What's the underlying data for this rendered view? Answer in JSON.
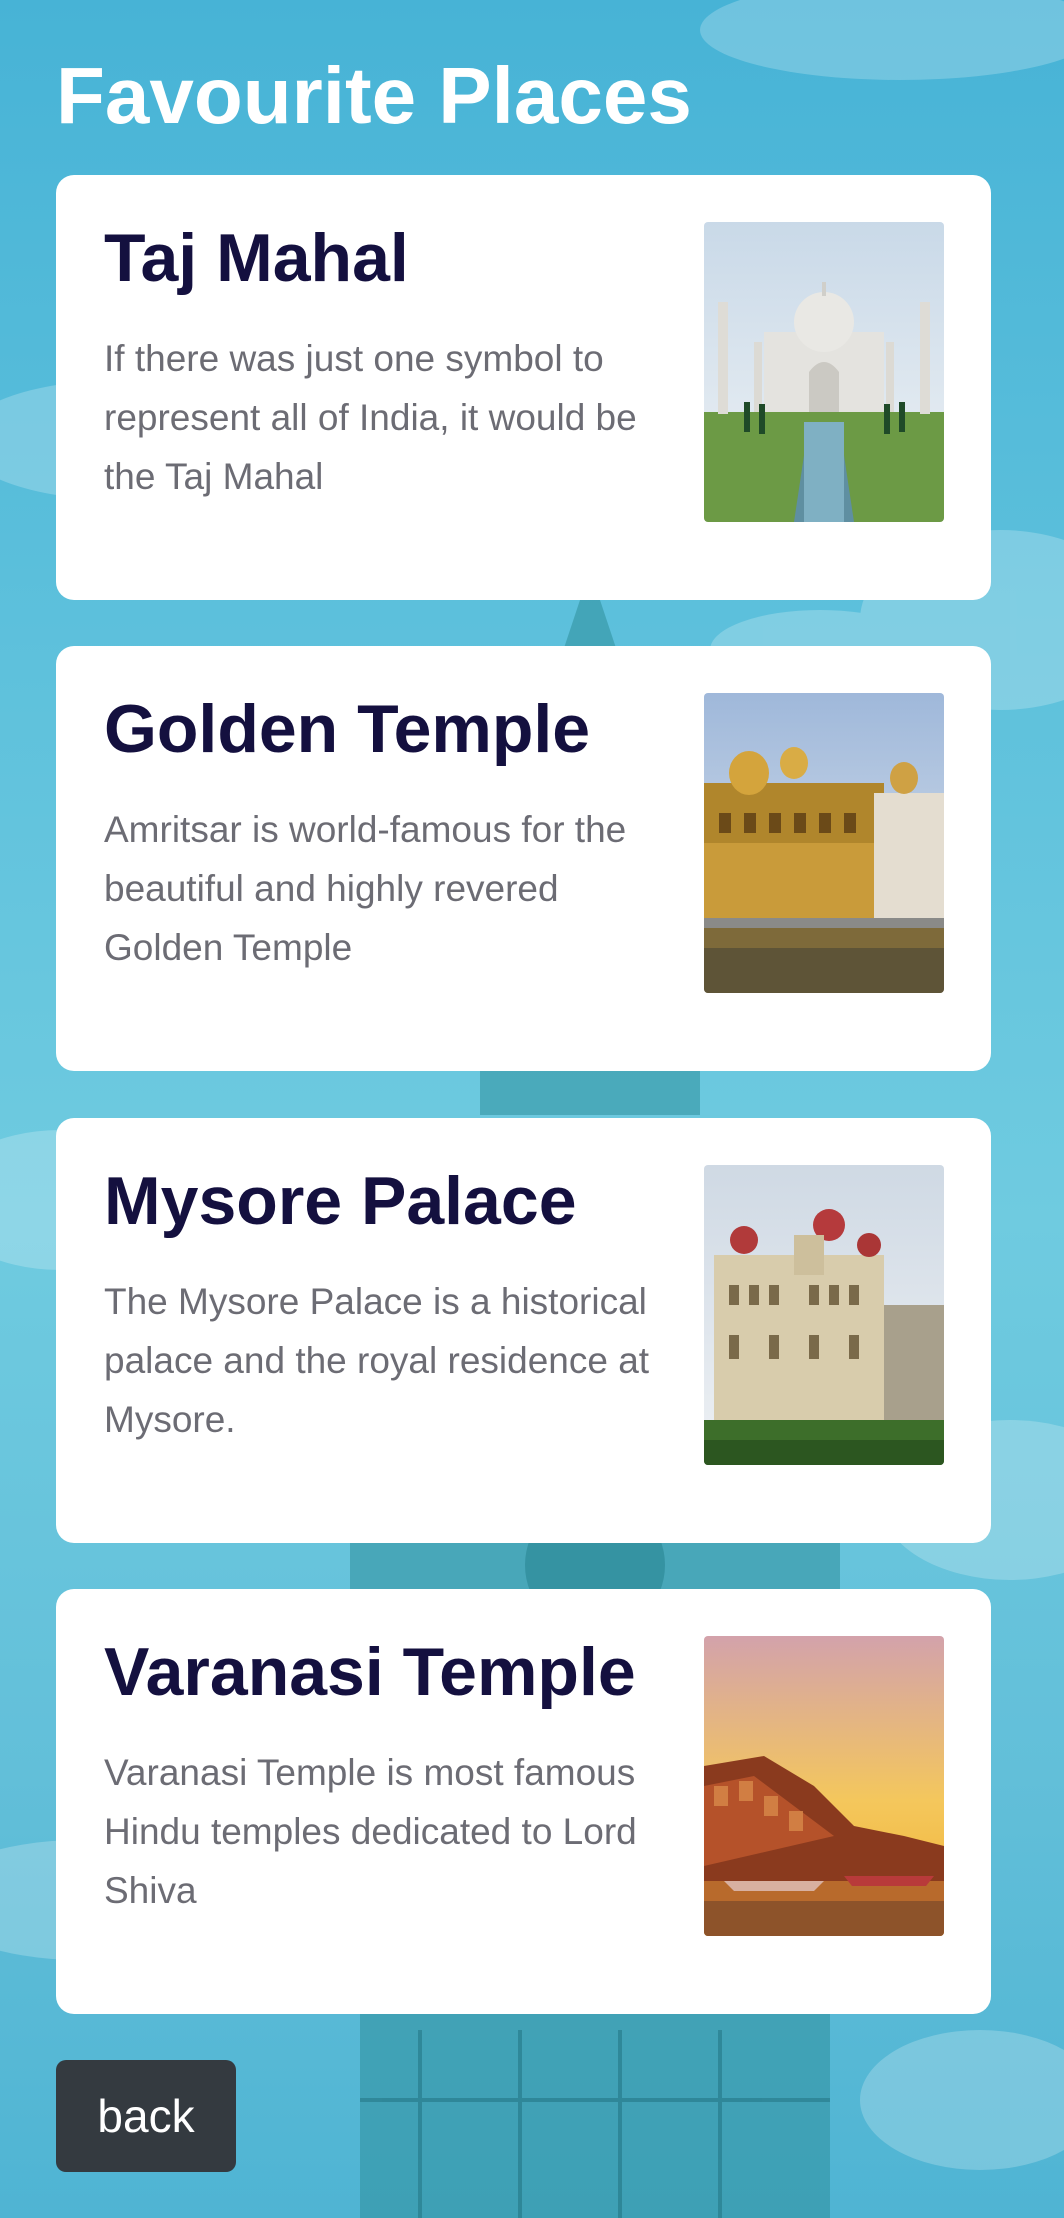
{
  "page": {
    "title": "Favourite Places"
  },
  "places": [
    {
      "title": "Taj Mahal",
      "description": "If there was just one symbol to represent all of India, it would be the Taj Mahal",
      "image": "taj-mahal-photo"
    },
    {
      "title": "Golden Temple",
      "description": "Amritsar is world-famous for the beautiful and highly revered Golden Temple",
      "image": "golden-temple-photo"
    },
    {
      "title": "Mysore Palace",
      "description": "The Mysore Palace is a historical palace and the royal residence at Mysore.",
      "image": "mysore-palace-photo"
    },
    {
      "title": "Varanasi Temple",
      "description": "Varanasi Temple is most famous Hindu temples dedicated to Lord Shiva",
      "image": "varanasi-ghat-photo"
    }
  ],
  "footer": {
    "back_label": "back"
  },
  "colors": {
    "title_text": "#14103f",
    "desc_text": "#6c6c74",
    "button_bg": "#343a40",
    "sky": "#5ec1dc"
  }
}
